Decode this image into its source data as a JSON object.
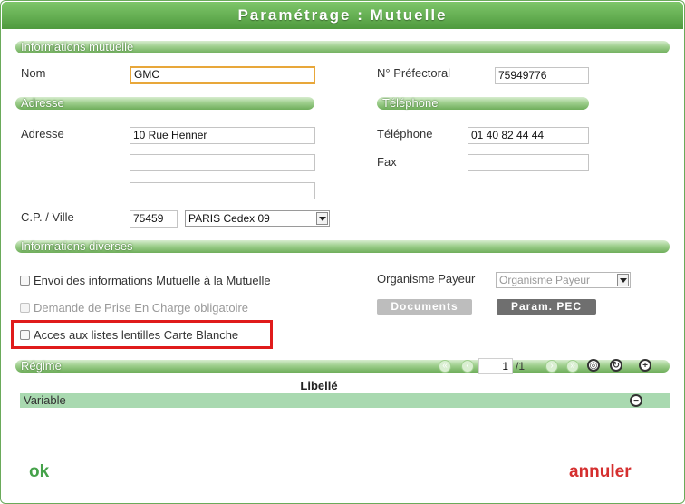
{
  "window": {
    "title": "Paramétrage : Mutuelle"
  },
  "sections": {
    "info_mutuelle": "Informations mutuelle",
    "adresse": "Adresse",
    "telephone": "Téléphone",
    "info_diverses": "Informations diverses",
    "regime": "Régime"
  },
  "fields": {
    "nom_label": "Nom",
    "nom_value": "GMC",
    "prefectoral_label": "N° Préfectoral",
    "prefectoral_value": "75949776",
    "adresse_label": "Adresse",
    "adresse_line1": "10 Rue Henner",
    "adresse_line2": "",
    "adresse_line3": "",
    "cp_ville_label": "C.P. / Ville",
    "cp_value": "75459",
    "ville_value": "PARIS Cedex 09",
    "telephone_label": "Téléphone",
    "telephone_value": "01 40 82 44 44",
    "fax_label": "Fax",
    "fax_value": ""
  },
  "options": {
    "envoi_label": "Envoi des informations Mutuelle à la Mutuelle",
    "envoi_checked": false,
    "prise_en_charge_label": "Demande de Prise En Charge obligatoire",
    "prise_en_charge_checked": false,
    "acces_listes_label": "Acces aux listes lentilles Carte Blanche",
    "acces_listes_checked": false,
    "organisme_label": "Organisme Payeur",
    "organisme_value": "Organisme Payeur",
    "documents_button": "Documents",
    "param_pec_button": "Param. PEC"
  },
  "regime": {
    "page_current": "1",
    "page_total": "/1",
    "column_header": "Libellé",
    "rows": [
      {
        "label": "Variable"
      }
    ],
    "icons": {
      "first": "first-page-icon",
      "prev": "prev-page-icon",
      "next": "next-page-icon",
      "last": "last-page-icon",
      "search": "search-icon",
      "refresh": "refresh-icon",
      "add": "add-icon",
      "remove": "remove-icon"
    }
  },
  "footer": {
    "ok_label": "ok",
    "cancel_label": "annuler"
  },
  "colors": {
    "accent_green": "#5aa848",
    "highlight_red": "#e01b1b",
    "focus_orange": "#e8a73a",
    "row_green": "#a9d9b0",
    "cancel_red": "#d52f2f"
  }
}
